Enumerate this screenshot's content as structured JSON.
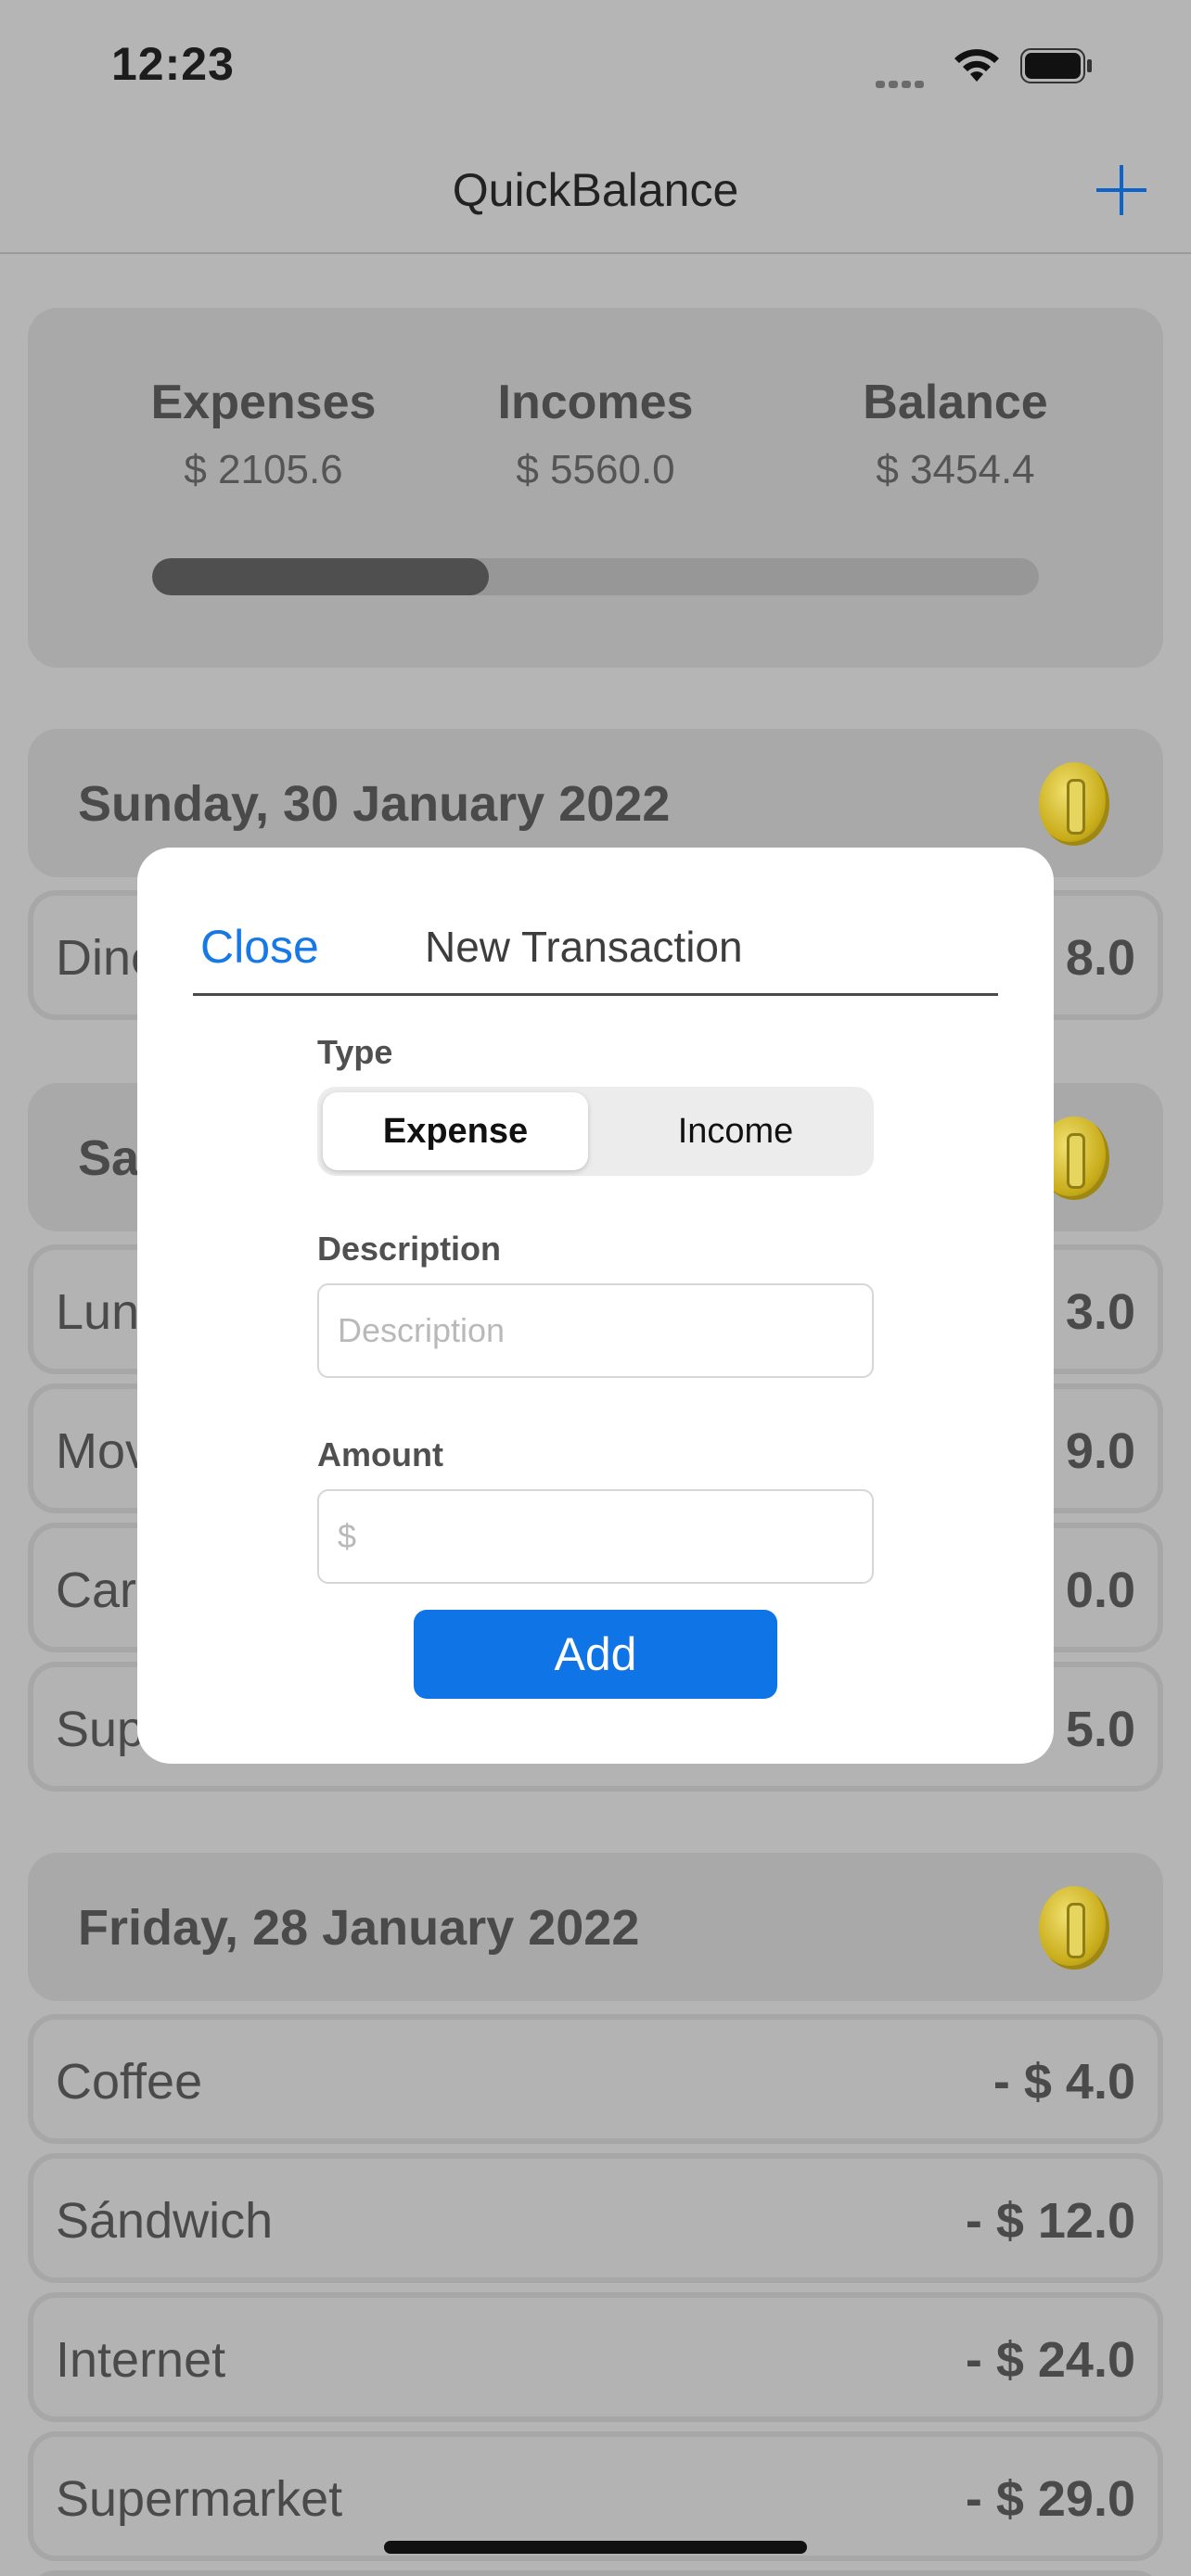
{
  "status_bar": {
    "time": "12:23"
  },
  "nav": {
    "title": "QuickBalance"
  },
  "summary": {
    "expenses_label": "Expenses",
    "expenses_value": "$ 2105.6",
    "incomes_label": "Incomes",
    "incomes_value": "$ 5560.0",
    "balance_label": "Balance",
    "balance_value": "$ 3454.4",
    "expense_ratio": 0.38
  },
  "days": [
    {
      "label": "Sunday, 30 January 2022",
      "transactions": [
        {
          "name": "Dine",
          "amount": "8.0"
        }
      ]
    },
    {
      "label": "Sa",
      "transactions": [
        {
          "name": "Lun",
          "amount": "3.0"
        },
        {
          "name": "Mov",
          "amount": "9.0"
        },
        {
          "name": "Car",
          "amount": "0.0"
        },
        {
          "name": "Sup",
          "amount": "5.0"
        }
      ]
    },
    {
      "label": "Friday, 28 January 2022",
      "transactions": [
        {
          "name": "Coffee",
          "amount": "- $ 4.0"
        },
        {
          "name": "Sándwich",
          "amount": "- $ 12.0"
        },
        {
          "name": "Internet",
          "amount": "- $ 24.0"
        },
        {
          "name": "Supermarket",
          "amount": "- $ 29.0"
        }
      ]
    }
  ],
  "modal": {
    "close_label": "Close",
    "title": "New Transaction",
    "type_label": "Type",
    "type_options": [
      "Expense",
      "Income"
    ],
    "selected_type": "Expense",
    "description_label": "Description",
    "description_placeholder": "Description",
    "description_value": "",
    "amount_label": "Amount",
    "amount_placeholder": "$",
    "amount_value": "",
    "add_label": "Add"
  },
  "colors": {
    "accent": "#0f74e5",
    "link": "#1679e6",
    "overlay_background": "#b5b5b5"
  }
}
